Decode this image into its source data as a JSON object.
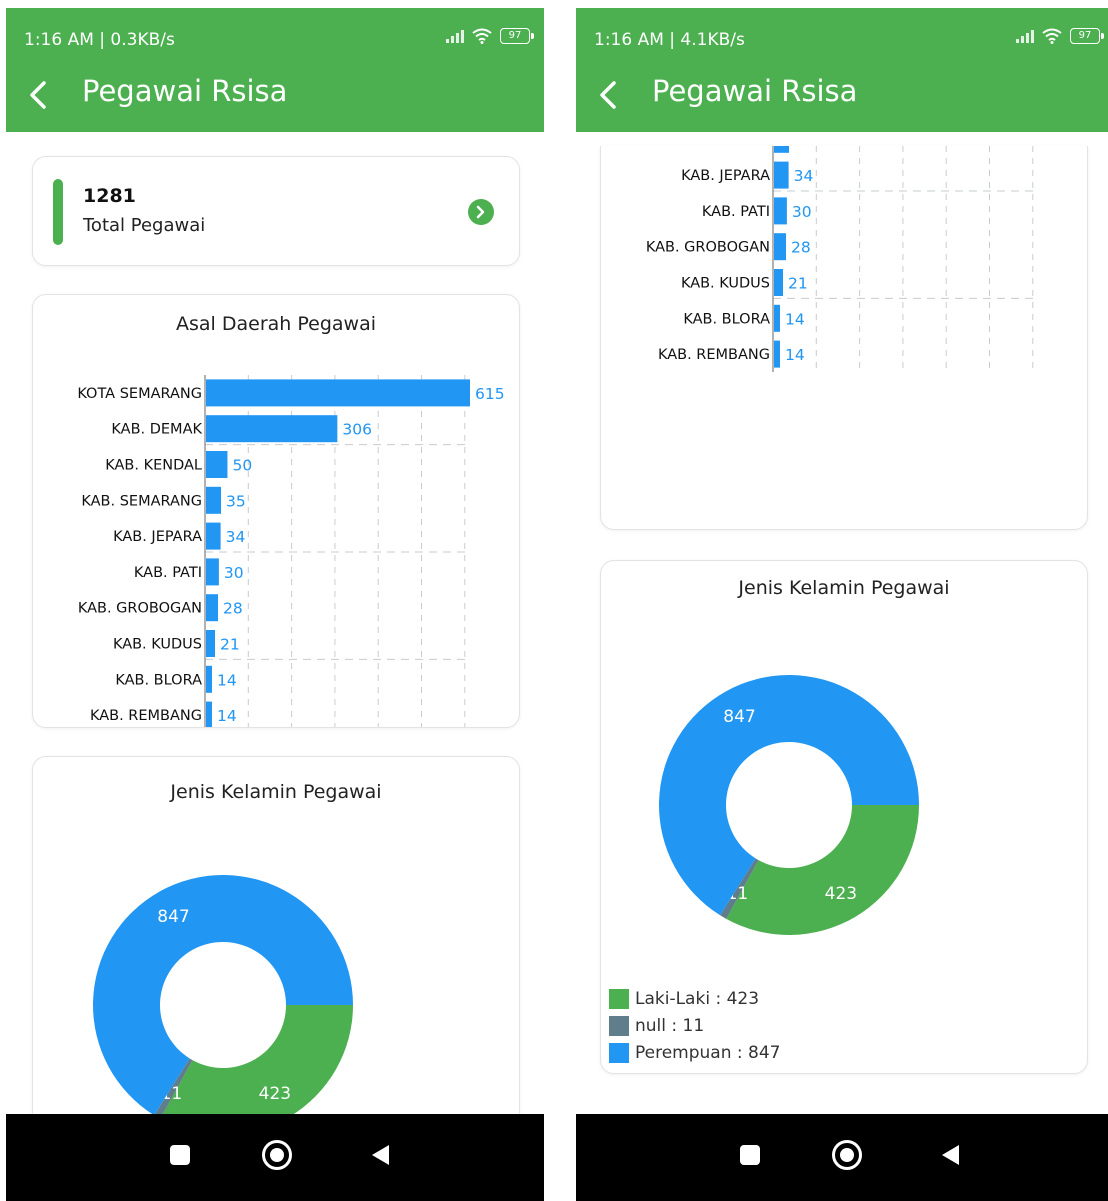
{
  "screens": [
    {
      "status_time": "1:16 AM | 0.3KB/s",
      "battery": "97",
      "title": "Pegawai Rsisa",
      "total": {
        "value": "1281",
        "label": "Total Pegawai"
      },
      "bar_title": "Asal Daerah Pegawai",
      "pie_title": "Jenis Kelamin Pegawai"
    },
    {
      "status_time": "1:16 AM | 4.1KB/s",
      "battery": "97",
      "title": "Pegawai Rsisa",
      "pie_title": "Jenis Kelamin Pegawai",
      "legend": [
        "Laki-Laki : 423",
        "null : 11",
        "Perempuan : 847"
      ]
    }
  ],
  "colors": {
    "appbar": "#4caf50",
    "bar": "#2196f3",
    "male": "#4caf50",
    "null": "#607d8b",
    "female": "#2196f3"
  },
  "chart_data": [
    {
      "type": "bar",
      "orientation": "horizontal",
      "title": "Asal Daerah Pegawai",
      "categories": [
        "KOTA SEMARANG",
        "KAB. DEMAK",
        "KAB. KENDAL",
        "KAB. SEMARANG",
        "KAB. JEPARA",
        "KAB. PATI",
        "KAB. GROBOGAN",
        "KAB. KUDUS",
        "KAB. BLORA",
        "KAB. REMBANG"
      ],
      "values": [
        615,
        306,
        50,
        35,
        34,
        30,
        28,
        21,
        14,
        14
      ],
      "xlim": [
        0,
        615
      ],
      "grid": true
    },
    {
      "type": "pie",
      "donut": true,
      "title": "Jenis Kelamin Pegawai",
      "categories": [
        "Laki-Laki",
        "null",
        "Perempuan"
      ],
      "values": [
        423,
        11,
        847
      ],
      "legend": "bottom-left"
    }
  ]
}
